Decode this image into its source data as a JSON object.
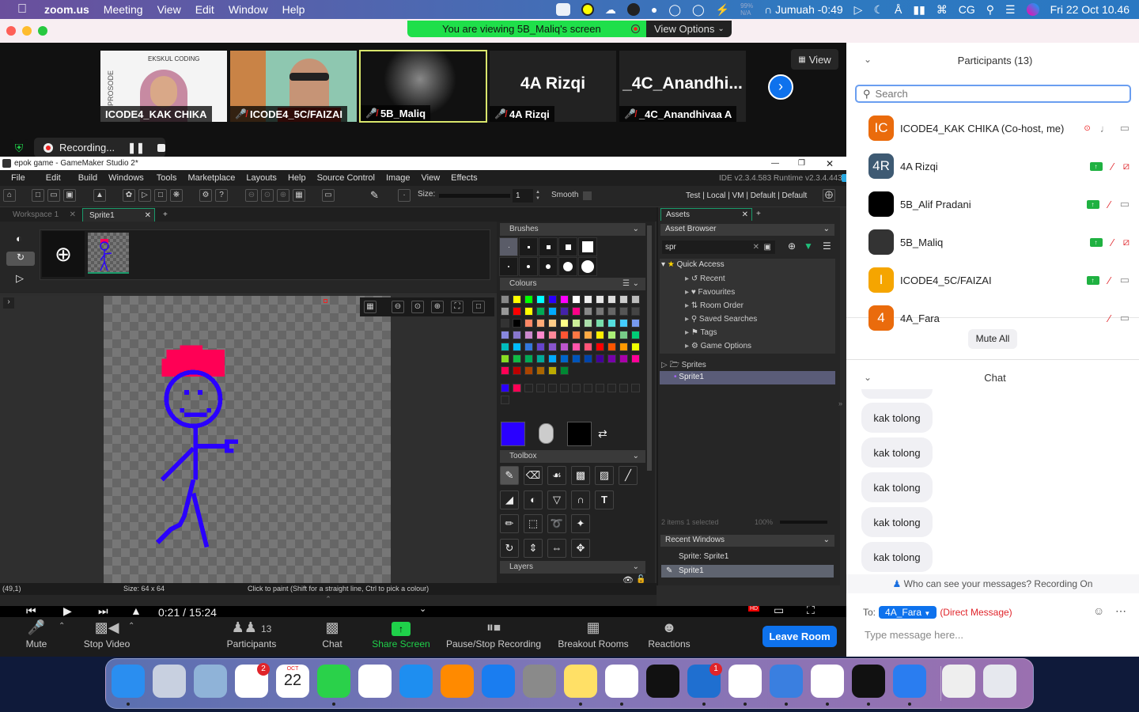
{
  "menubar": {
    "app_name": "zoom.us",
    "items": [
      "Meeting",
      "View",
      "Edit",
      "Window",
      "Help"
    ],
    "battery_pct": "99%",
    "battery_sub": "N/A",
    "prayer": "Jumuah -0:49",
    "user_initials": "CG",
    "datetime": "Fri 22 Oct  10.46"
  },
  "zoom": {
    "banner": "You are viewing 5B_Maliq's screen",
    "view_options": "View Options",
    "view_button": "View",
    "recording_label": "Recording...",
    "videos": [
      {
        "name": "ICODE4_KAK CHIKA",
        "muted": false,
        "overlay_text": "EKSKUL CODING"
      },
      {
        "name": "ICODE4_5C/FAIZAI",
        "muted": true
      },
      {
        "name": "5B_Maliq",
        "muted": true,
        "active": true
      },
      {
        "name": "4A Rizqi",
        "muted": true,
        "big_text": "4A Rizqi"
      },
      {
        "name": "_4C_Anandhivaa A",
        "muted": true,
        "big_text": "_4C_Anandhi..."
      }
    ]
  },
  "gms": {
    "window_title": "epok game - GameMaker Studio 2*",
    "menu": [
      "File",
      "Edit",
      "Build",
      "Windows",
      "Tools",
      "Marketplace",
      "Layouts",
      "Help",
      "Source Control",
      "Image",
      "View",
      "Effects"
    ],
    "version": "IDE v2.3.4.583  Runtime v2.3.4.443",
    "size_label": "Size:",
    "size_value": "1",
    "smooth_label": "Smooth",
    "targets": "Test | Local | VM | Default | Default",
    "tabs": [
      "Workspace 1",
      "Sprite1"
    ],
    "brushes_title": "Brushes",
    "colours_title": "Colours",
    "toolbox_title": "Toolbox",
    "layers_title": "Layers",
    "primary_colour": "#2a00ff",
    "secondary_colour": "#000000",
    "palette": [
      [
        "#888888",
        "#ffff00",
        "#00ff00",
        "#00ffff",
        "#2a00ff",
        "#ff00ff",
        "#ffffff",
        "#eeeeee",
        "#e6e6e6",
        "#dddddd",
        "#cccccc",
        "#bbbbbb"
      ],
      [
        "#999999",
        "#ff0000",
        "#ffff00",
        "#00aa55",
        "#00aaff",
        "#4422aa",
        "#ff0088",
        "#888888",
        "#777777",
        "#666666",
        "#555555",
        "#444444"
      ],
      [
        "#333333",
        "#000000",
        "#ff8866",
        "#ffaa77",
        "#ffcc88",
        "#ffff88",
        "#ccee99",
        "#aaddaa",
        "#77ddaa",
        "#55dddd",
        "#44ccff",
        "#7799ee"
      ],
      [
        "#8888dd",
        "#8877cc",
        "#cc88cc",
        "#ff88cc",
        "#ff8899",
        "#ff5533",
        "#ff7744",
        "#ffaa44",
        "#ffee00",
        "#aaee77",
        "#77cc88",
        "#00cc77"
      ],
      [
        "#00bbbb",
        "#00bbff",
        "#3377dd",
        "#6644cc",
        "#8855cc",
        "#bb55cc",
        "#ff55aa",
        "#ff5577",
        "#ff0000",
        "#ff5500",
        "#ff9900",
        "#eeff00"
      ],
      [
        "#88dd22",
        "#11bb44",
        "#00aa55",
        "#00aa99",
        "#00aaff",
        "#0066cc",
        "#0055bb",
        "#0044aa",
        "#440099",
        "#7700aa",
        "#aa00aa",
        "#ff0099"
      ],
      [
        "#ff0055",
        "#bb0000",
        "#aa4400",
        "#aa6600",
        "#bbaa00",
        "#008833"
      ]
    ],
    "recent_colours": [
      "#2a00ff",
      "#ff0055"
    ],
    "assets_tab": "Assets",
    "asset_browser": "Asset Browser",
    "asset_search": "spr",
    "quick_access": "Quick Access",
    "tree_items": [
      "Recent",
      "Favourites",
      "Room Order",
      "Saved Searches",
      "Tags",
      "Game Options"
    ],
    "folder": "Sprites",
    "selected_asset": "Sprite1",
    "asset_status": "2 items    1 selected",
    "asset_zoom": "100%",
    "recent_windows_title": "Recent Windows",
    "recent_windows": [
      "Sprite: Sprite1",
      "Sprite1"
    ],
    "status_coords": "(49,1)",
    "status_size": "Size: 64 x 64",
    "status_hint": "Click to paint (Shift for a straight line, Ctrl to pick a colour)"
  },
  "video_player": {
    "time": "0:21 / 15:24",
    "hd_badge": "HD"
  },
  "participants": {
    "title": "Participants (13)",
    "search_placeholder": "Search",
    "list": [
      {
        "initials": "IC",
        "name": "ICODE4_KAK CHIKA (Co-host, me)",
        "color": "#ea6b0c",
        "hand_up": false,
        "mic_muted": false,
        "video_off": false,
        "recording": true
      },
      {
        "initials": "4R",
        "name": "4A Rizqi",
        "color": "#3e5a73",
        "hand_up": true,
        "mic_muted": true,
        "video_off": true
      },
      {
        "initials": "",
        "name": "5B_Alif Pradani",
        "color": "#000000",
        "hand_up": true,
        "mic_muted": true,
        "video_off": false
      },
      {
        "initials": "",
        "name": "5B_Maliq",
        "color": "#333333",
        "hand_up": true,
        "mic_muted": true,
        "video_off": true
      },
      {
        "initials": "I",
        "name": "ICODE4_5C/FAIZAI",
        "color": "#f5a500",
        "hand_up": true,
        "mic_muted": true,
        "video_off": false
      },
      {
        "initials": "4",
        "name": "4A_Fara",
        "color": "#ea6b0c",
        "hand_up": false,
        "mic_muted": true,
        "video_off": false
      }
    ],
    "mute_all": "Mute All"
  },
  "chat": {
    "title": "Chat",
    "messages": [
      "kak tolong",
      "kak tolong",
      "kak tolong",
      "kak tolong",
      "kak tolong"
    ],
    "privacy_note": "Who can see your messages? Recording On",
    "to_label": "To:",
    "recipient": "4A_Fara",
    "direct_label": "(Direct Message)",
    "input_placeholder": "Type message here..."
  },
  "toolbar": {
    "mute": "Mute",
    "stop_video": "Stop Video",
    "participants": "Participants",
    "participant_count": "13",
    "chat": "Chat",
    "share_screen": "Share Screen",
    "recording": "Pause/Stop Recording",
    "breakout": "Breakout Rooms",
    "reactions": "Reactions",
    "leave": "Leave Room"
  },
  "dock": {
    "apps": [
      {
        "name": "finder",
        "color": "#2a8ef0",
        "running": true
      },
      {
        "name": "launchpad",
        "color": "#c8d0e0",
        "running": false
      },
      {
        "name": "preview",
        "color": "#8fb3d8",
        "running": false
      },
      {
        "name": "reminders",
        "color": "#ffffff",
        "running": false,
        "badge": "2"
      },
      {
        "name": "calendar",
        "color": "#ffffff",
        "running": false,
        "label": "22",
        "sub": "OCT"
      },
      {
        "name": "messages",
        "color": "#2ad14a",
        "running": true
      },
      {
        "name": "photos",
        "color": "#ffffff",
        "running": false
      },
      {
        "name": "keynote",
        "color": "#1e8ef0",
        "running": false
      },
      {
        "name": "books",
        "color": "#ff8a00",
        "running": false
      },
      {
        "name": "app-store",
        "color": "#1a7df0",
        "running": false
      },
      {
        "name": "system-preferences",
        "color": "#8a8a8a",
        "running": false
      },
      {
        "name": "notes",
        "color": "#ffe066",
        "running": true
      },
      {
        "name": "safari",
        "color": "#ffffff",
        "running": true
      },
      {
        "name": "terminal",
        "color": "#111111",
        "running": false
      },
      {
        "name": "blue-app",
        "color": "#1f6fd0",
        "running": true,
        "badge": "1"
      },
      {
        "name": "chrome",
        "color": "#ffffff",
        "running": true
      },
      {
        "name": "blue-bubble",
        "color": "#3a7fe0",
        "running": true
      },
      {
        "name": "system-info",
        "color": "#ffffff",
        "running": true
      },
      {
        "name": "gamemaker",
        "color": "#111111",
        "running": true
      },
      {
        "name": "zoom",
        "color": "#2a7df0",
        "running": true
      },
      {
        "name": "archive",
        "color": "#eeeeee",
        "running": false
      },
      {
        "name": "trash",
        "color": "#e6e8ee",
        "running": false
      }
    ]
  }
}
